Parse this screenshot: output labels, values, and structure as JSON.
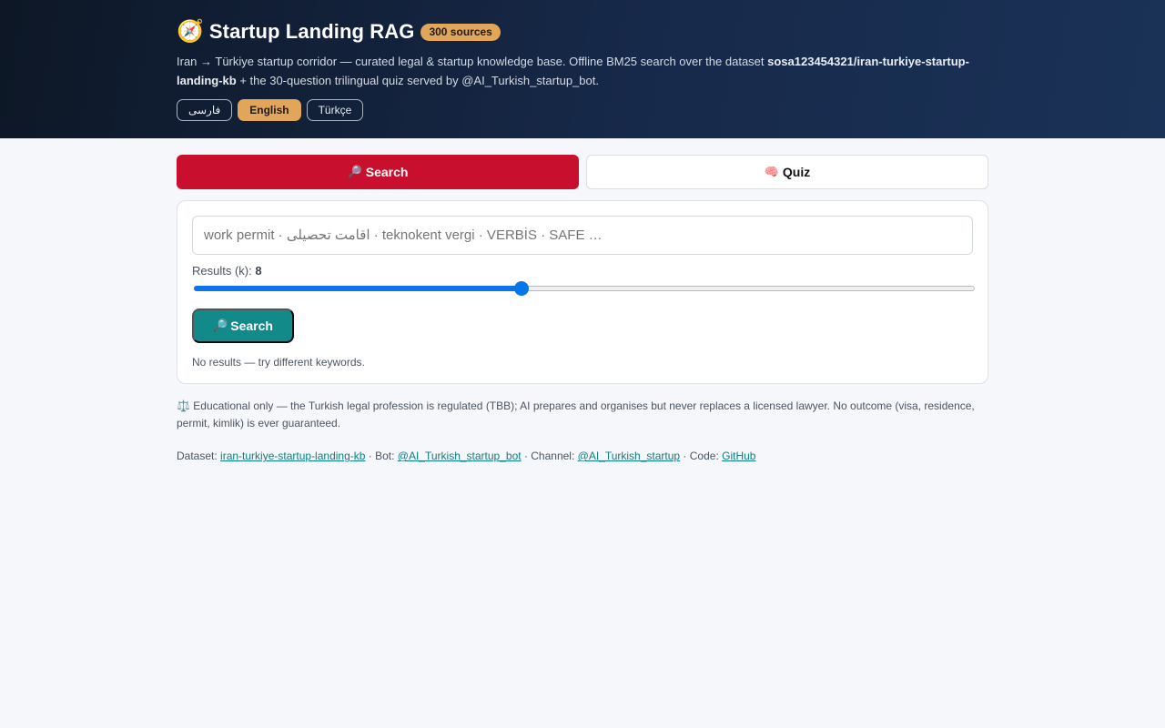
{
  "header": {
    "icon": "compass-icon",
    "icon_glyph": "🧭",
    "title": "Startup Landing RAG",
    "badge": "300 sources",
    "desc_prefix": "Iran → Türkiye startup corridor — curated legal & startup knowledge base. Offline BM25 search over the dataset ",
    "desc_dataset": "sosa123454321/iran-turkiye-startup-landing-kb",
    "desc_suffix": " + the 30-question trilingual quiz served by @AI_Turkish_startup_bot.",
    "languages": [
      {
        "label": "فارسی",
        "active": false
      },
      {
        "label": "English",
        "active": true
      },
      {
        "label": "Türkçe",
        "active": false
      }
    ]
  },
  "tabs": [
    {
      "icon_glyph": "🔎",
      "label": "Search",
      "active": true
    },
    {
      "icon_glyph": "🧠",
      "label": "Quiz",
      "active": false
    }
  ],
  "search": {
    "placeholder": "work permit · اقامت تحصیلی · teknokent vergi · VERBİS · SAFE …",
    "k_label": "Results (k): ",
    "k_value": "8",
    "k_fraction": 0.42,
    "button_icon": "🔎",
    "button_label": "Search",
    "empty_message": "No results — try different keywords."
  },
  "disclaimer": {
    "icon_glyph": "⚖️",
    "text": "Educational only — the Turkish legal profession is regulated (TBB); AI prepares and organises but never replaces a licensed lawyer. No outcome (visa, residence, permit, kimlik) is ever guaranteed."
  },
  "footer": {
    "dataset_label": "Dataset: ",
    "dataset_link": "iran-turkiye-startup-landing-kb",
    "sep1": " · Bot: ",
    "bot_link": "@AI_Turkish_startup_bot",
    "sep2": " · Channel: ",
    "channel_link": "@AI_Turkish_startup",
    "sep3": " · Code: ",
    "code_link": "GitHub"
  },
  "colors": {
    "accent_red": "#c8102e",
    "accent_teal": "#138a8a",
    "badge_gold": "#e2a65a",
    "slider_blue": "#0a75e8"
  }
}
